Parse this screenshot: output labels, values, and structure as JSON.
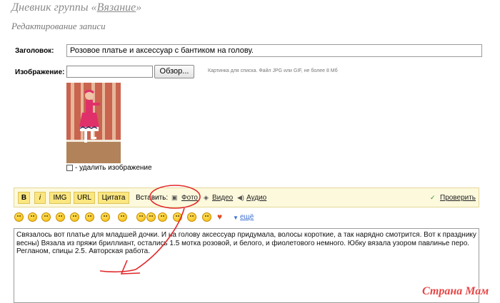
{
  "header": {
    "title_prefix": "Дневник группы «",
    "group_name": "Вязание",
    "title_suffix": "»",
    "subtitle": "Редактирование записи"
  },
  "form": {
    "title_label": "Заголовок:",
    "title_value": "Розовое платье и аксессуар с бантиком на голову.",
    "image_label": "Изображение:",
    "file_value": "",
    "browse_label": "Обзор...",
    "image_hint": "Картинка для списка. Файл JPG или GIF, не более 8 Мб",
    "delete_image_label": "- удалить изображение"
  },
  "toolbar": {
    "bold": "B",
    "italic": "i",
    "img": "IMG",
    "url": "URL",
    "quote": "Цитата",
    "insert_label": "Вставить:",
    "photo": "Фото",
    "video": "Видео",
    "audio": "Аудио",
    "check": "Проверить"
  },
  "smileys": {
    "count": 16,
    "more_label": "ещё"
  },
  "body_text": "Связалось вот платье для младшей дочки. И на голову аксессуар придумала, волосы короткие, а так нарядно смотрится. Вот к празднику весны) Вязала из пряжи бриллиант, остались 1.5 мотка розовой, и белого, и фиолетового немного. Юбку вязала узором павлинье перо. Регланом, спицы 2.5. Авторская работа.",
  "watermark": "Страна Мам",
  "colors": {
    "toolbar_bg": "#fdf9dd",
    "button_bg": "#fbe680",
    "link_blue": "#3b6fd3",
    "annotation_red": "#e0282a",
    "watermark_red": "#e64646"
  }
}
